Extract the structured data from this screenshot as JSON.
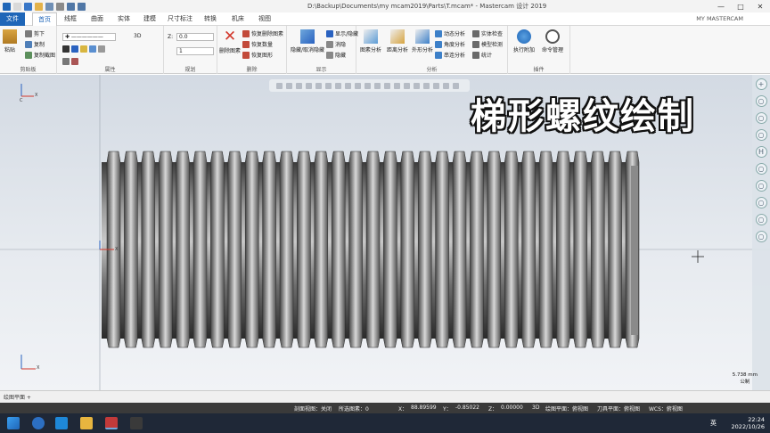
{
  "window": {
    "title": "D:\\Backup\\Documents\\my mcam2019\\Parts\\T.mcam* - Mastercam 设计 2019",
    "brand": "MY MASTERCAM",
    "controls": [
      "—",
      "□",
      "✕"
    ]
  },
  "tabs": [
    "文件",
    "首页",
    "线框",
    "曲面",
    "实体",
    "建模",
    "尺寸标注",
    "转换",
    "机床",
    "视图"
  ],
  "active_tab_index": 1,
  "ribbon": {
    "clipboard": {
      "paste": "粘贴",
      "cut": "剪下",
      "copy": "复制",
      "paste_image": "复制截图",
      "label": "剪贴板"
    },
    "attributes": {
      "dim_3d": "3D",
      "label": "属性"
    },
    "planes": {
      "z_label": "Z:",
      "z_value": "0.0",
      "level_value": "1",
      "label": "规划"
    },
    "delete": {
      "delete_entity": "删除图素",
      "recover_all": "恢复删除图素",
      "recover_count": "恢复数量",
      "recover_marked": "恢复图形",
      "label": "删除"
    },
    "display": {
      "hide_unhide": "隐藏/取消隐藏",
      "show_hide": "显示/隐藏",
      "blank": "消隐",
      "hide": "隐藏",
      "label": "显示"
    },
    "analyze": {
      "entity_analysis": "图素分析",
      "distance_analysis": "距离分析",
      "dynamic_analysis": "动态分析",
      "angle_analysis": "角度分析",
      "chain_analysis": "串连分析",
      "contour_analysis": "外形分析",
      "solid_check": "实体检查",
      "model_analysis": "模型检测",
      "statistics": "统计",
      "label": "分析"
    },
    "macro": {
      "run_addin": "执行附加",
      "manage": "命令管理",
      "label": "插件"
    }
  },
  "overlay_title": "梯形螺纹绘制",
  "rightbar_icons": [
    "+",
    "○",
    "○",
    "○",
    "H",
    "○",
    "○",
    "○",
    "○",
    "○"
  ],
  "viewport": {
    "axis_x": "X",
    "axis_y": "Y",
    "axis_c": "C",
    "scale_value": "5.738 mm",
    "scale_unit": "公制"
  },
  "sheet_tab": "绘图平面 +",
  "status": {
    "section_view": "剖面视图：关闭",
    "selected": "所选图素：0",
    "x": "X：",
    "x_val": "88.89599",
    "y": "Y：",
    "y_val": "-0.85022",
    "z": "Z：",
    "z_val": "0.00000",
    "dim": "3D",
    "cplane": "绘图平面：俯视图",
    "tplane": "刀具平面：俯视图",
    "wcs": "WCS：俯视图"
  },
  "taskbar": {
    "ime": "英",
    "time": "22:24",
    "date": "2022/10/26"
  },
  "colors": {
    "file_tab": "#1f66b8",
    "taskbar": "#1f2837",
    "statusbar": "#3a3a3a",
    "title_text": "#ffffff"
  }
}
